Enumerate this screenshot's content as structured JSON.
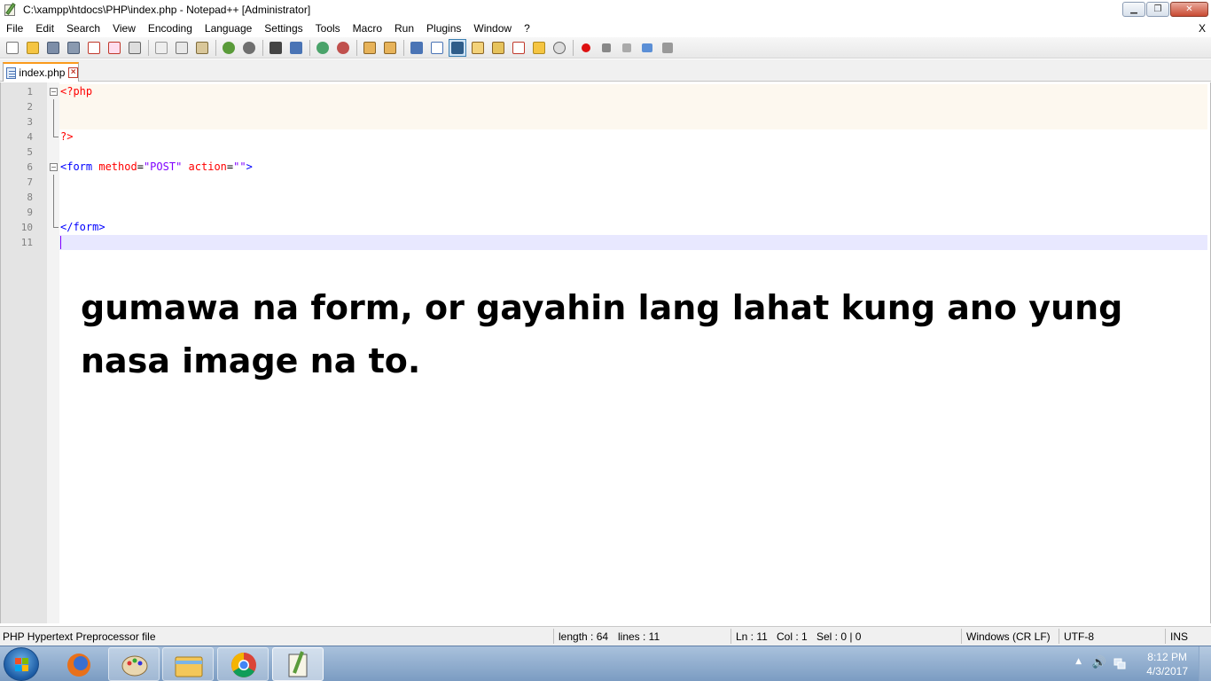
{
  "window": {
    "title": "C:\\xampp\\htdocs\\PHP\\index.php - Notepad++ [Administrator]",
    "min_glyph": "▁",
    "max_glyph": "❐",
    "close_glyph": "✕"
  },
  "menu": {
    "items": [
      "File",
      "Edit",
      "Search",
      "View",
      "Encoding",
      "Language",
      "Settings",
      "Tools",
      "Macro",
      "Run",
      "Plugins",
      "Window",
      "?"
    ],
    "close_glyph": "X"
  },
  "tab": {
    "label": "index.php",
    "close_glyph": "×"
  },
  "editor": {
    "line_numbers": [
      "1",
      "2",
      "3",
      "4",
      "5",
      "6",
      "7",
      "8",
      "9",
      "10",
      "11"
    ],
    "line1": "<?php",
    "line4": "?>",
    "line6_open": "<form",
    "line6_attr1": "method",
    "line6_eq1": "=",
    "line6_val1": "\"POST\"",
    "line6_attr2": "action",
    "line6_eq2": "=",
    "line6_val2": "\"\"",
    "line6_close": ">",
    "line10": "</form>"
  },
  "overlay_note": "gumawa na form, or gayahin lang lahat kung ano yung nasa image na to.",
  "status": {
    "file_type": "PHP Hypertext Preprocessor file",
    "length": "length : 64",
    "lines": "lines : 11",
    "ln": "Ln : 11",
    "col": "Col : 1",
    "sel": "Sel : 0 | 0",
    "eol": "Windows (CR LF)",
    "encoding": "UTF-8",
    "mode": "INS"
  },
  "taskbar": {
    "time": "8:12 PM",
    "date": "4/3/2017",
    "tray_chevron": "▲",
    "volume_glyph": "🔊"
  },
  "colors": {
    "php_delim": "#ff0000",
    "html_tag": "#0000ff",
    "attribute": "#ff0000",
    "string": "#8000ff",
    "tab_accent": "#fa9a1c",
    "current_line": "#e8e8ff"
  }
}
